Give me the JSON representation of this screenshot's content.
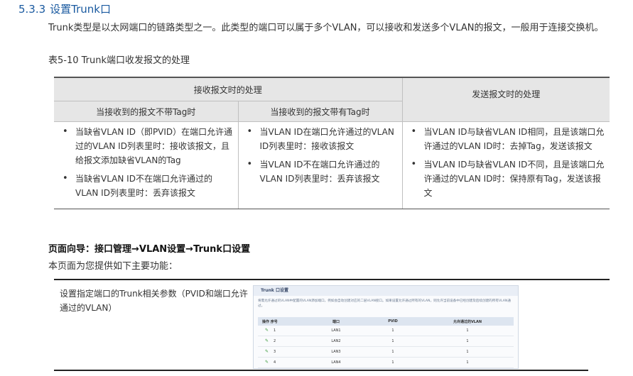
{
  "section": {
    "number": "5.3.3",
    "title": "设置Trunk口"
  },
  "intro_paragraph": "Trunk类型是以太网端口的链路类型之一。此类型的端口可以属于多个VLAN，可以接收和发送多个VLAN的报文，一般用于连接交换机。",
  "table_caption": "表5-10 Trunk端口收发报文的处理",
  "table": {
    "header_receive": "接收报文时的处理",
    "header_send": "发送报文时的处理",
    "sub_untagged": "当接收到的报文不带Tag时",
    "sub_tagged": "当接收到的报文带有Tag时",
    "col1": [
      "当缺省VLAN ID（即PVID）在端口允许通过的VLAN ID列表里时：接收该报文，且给报文添加缺省VLAN的Tag",
      "当缺省VLAN ID不在端口允许通过的VLAN ID列表里时：丢弃该报文"
    ],
    "col2": [
      "当VLAN ID在端口允许通过的VLAN ID列表里时：接收该报文",
      "当VLAN ID不在端口允许通过的VLAN ID列表里时：丢弃该报文"
    ],
    "col3": [
      "当VLAN ID与缺省VLAN ID相同，且是该端口允许通过的VLAN ID时：去掉Tag，发送该报文",
      "当VLAN ID与缺省VLAN ID不同，且是该端口允许通过的VLAN ID时：保持原有Tag，发送该报文"
    ]
  },
  "page_nav": "页面向导：接口管理→VLAN设置→Trunk口设置",
  "features_intro": "本页面为您提供如下主要功能：",
  "feature": {
    "description": "设置指定端口的Trunk相关参数（PVID和端口允许通过的VLAN）",
    "screenshot": {
      "title": "Trunk 口设置",
      "desc": "将需允许通过的VLAN中配置的VLAN添加端口，例如会自动创建对应的二层VLAN接口。如果设置允许通过所有的VLAN，则允许当前设备中已经创建及后续创建的所有VLAN通过。",
      "headers": [
        "操作 序号",
        "端口",
        "PVID",
        "允许通过的VLAN"
      ],
      "rows": [
        {
          "no": "1",
          "port": "LAN1",
          "pvid": "1",
          "vlan": "1"
        },
        {
          "no": "2",
          "port": "LAN2",
          "pvid": "1",
          "vlan": "1"
        },
        {
          "no": "3",
          "port": "LAN3",
          "pvid": "1",
          "vlan": "1"
        },
        {
          "no": "4",
          "port": "LAN4",
          "pvid": "1",
          "vlan": "1"
        }
      ]
    }
  }
}
